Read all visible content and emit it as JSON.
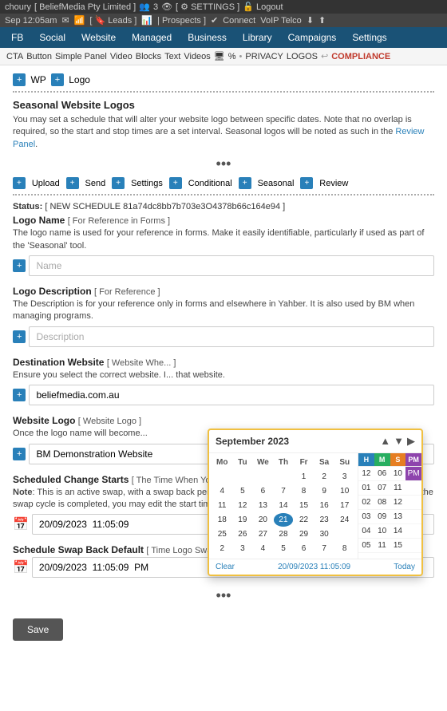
{
  "topbar": {
    "user": "choury",
    "company": "BeliefMedia Pty Limited",
    "icons": "3",
    "settings_label": "SETTINGS",
    "logout_label": "Logout",
    "time": "Sep 12:05am",
    "leads_label": "Leads",
    "prospects_label": "Prospects",
    "connect_label": "Connect",
    "voip_label": "VoIP Telco"
  },
  "navbar": {
    "items": [
      {
        "label": "FB",
        "id": "fb"
      },
      {
        "label": "Social",
        "id": "social"
      },
      {
        "label": "Website",
        "id": "website"
      },
      {
        "label": "Managed",
        "id": "managed"
      },
      {
        "label": "Business",
        "id": "business"
      },
      {
        "label": "Library",
        "id": "library"
      },
      {
        "label": "Campaigns",
        "id": "campaigns"
      },
      {
        "label": "Settings",
        "id": "settings"
      }
    ]
  },
  "subnav": {
    "items": [
      {
        "label": "CTA",
        "id": "cta"
      },
      {
        "label": "Button",
        "id": "button"
      },
      {
        "label": "Simple Panel",
        "id": "simple-panel"
      },
      {
        "label": "Video",
        "id": "video"
      },
      {
        "label": "Blocks",
        "id": "blocks"
      },
      {
        "label": "Text",
        "id": "text"
      },
      {
        "label": "Videos",
        "id": "videos"
      },
      {
        "label": "PRIVACY",
        "id": "privacy"
      },
      {
        "label": "LOGOS",
        "id": "logos"
      },
      {
        "label": "COMPLIANCE",
        "id": "compliance"
      }
    ]
  },
  "wp_label": "WP",
  "logo_label": "Logo",
  "section_title": "Seasonal Website Logos",
  "section_desc": "You may set a schedule that will alter your website logo between specific dates. Note that no overlap is required, so the start and stop times are a set interval. Seasonal logos will be noted as such in the Review Panel.",
  "review_panel_link": "Review Panel",
  "tools": {
    "upload": "Upload",
    "send": "Send",
    "settings": "Settings",
    "conditional": "Conditional",
    "seasonal": "Seasonal",
    "review": "Review"
  },
  "status": {
    "label": "Status:",
    "value": "[ NEW SCHEDULE 81a74dc8bb7b703e3O4378b66c164e94 ]"
  },
  "logo_name_field": {
    "label": "Logo Name",
    "sub_label": "[ For Reference in Forms ]",
    "desc": "The logo name is used for your reference in forms. Make it easily identifiable, particularly if used as part of the 'Seasonal' tool.",
    "placeholder": "Name"
  },
  "logo_desc_field": {
    "label": "Logo Description",
    "sub_label": "[ For Reference ]",
    "desc": "The Description is for your reference only in forms and elsewhere in Yahber. It is also used by BM when managing programs.",
    "placeholder": "Description"
  },
  "dest_website_field": {
    "label": "Destination Website",
    "sub_label": "[ Website Whe... ]",
    "desc": "Ensure you select the correct website. I... that website.",
    "value": "beliefmedia.com.au"
  },
  "website_logo_field": {
    "label": "Website Logo",
    "sub_label": "[ Website Logo ]",
    "desc": "Once the logo name will become...",
    "value": "BM Demonstration Website"
  },
  "scheduled_change_field": {
    "label": "Scheduled Change Starts",
    "sub_label": "[ The Time When Your Logo Will Swap ]",
    "note_label": "Note",
    "note_text": "This is an active swap, with a swap back pending. You cannot edit the start time in this case. Once the swap cycle is completed, you may edit the start time.",
    "value": "20/09/2023  11:05:09"
  },
  "schedule_swap_field": {
    "label": "Schedule Swap Back Default",
    "sub_label": "[ Time Logo Swaps Back to Default ]",
    "value": "20/09/2023  11:05:09  PM"
  },
  "save_label": "Save",
  "calendar": {
    "month_year": "September 2023",
    "days_of_week": [
      "Mo",
      "Tu",
      "We",
      "Th",
      "Fr",
      "Sa",
      "Su"
    ],
    "days": [
      [
        "",
        "",
        "",
        "",
        "1",
        "2",
        "3"
      ],
      [
        "4",
        "5",
        "6",
        "7",
        "8",
        "9",
        "10"
      ],
      [
        "11",
        "12",
        "13",
        "14",
        "15",
        "16",
        "17"
      ],
      [
        "18",
        "19",
        "20",
        "21",
        "22",
        "23",
        "24"
      ],
      [
        "25",
        "26",
        "27",
        "28",
        "29",
        "30",
        ""
      ],
      [
        "2",
        "3",
        "4",
        "5",
        "6",
        "7",
        "8"
      ]
    ],
    "selected_day": "21",
    "time_headers": [
      "H",
      "M",
      "S",
      "PM"
    ],
    "time_rows": [
      [
        "12",
        "06",
        "10",
        "PM"
      ],
      [
        "01",
        "07",
        "11",
        ""
      ],
      [
        "02",
        "08",
        "12",
        ""
      ],
      [
        "03",
        "09",
        "13",
        ""
      ],
      [
        "04",
        "10",
        "14",
        ""
      ],
      [
        "05",
        "11",
        "15",
        ""
      ]
    ],
    "clear_label": "Clear",
    "today_label": "Today",
    "displayed_datetime": "20/09/2023  11:05:09",
    "pre_selected": [
      "11",
      "05",
      "09"
    ]
  }
}
